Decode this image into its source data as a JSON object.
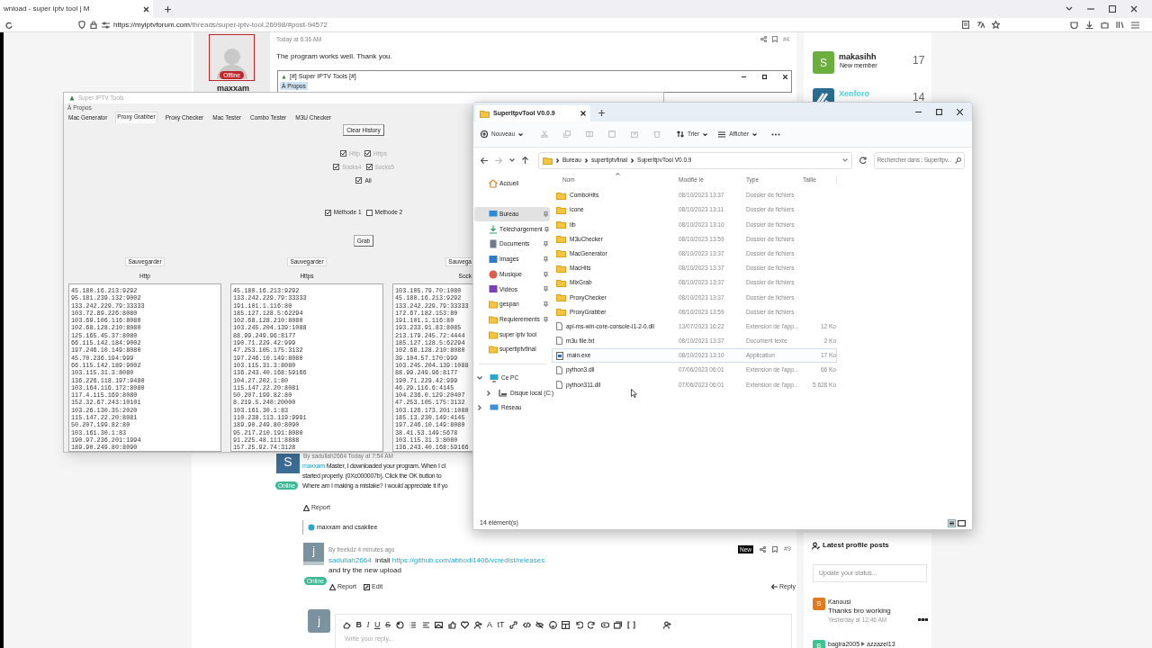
{
  "browser": {
    "tab_title": "wnload - super iptv tool | M",
    "url_host": "https://myiptvforum.com",
    "url_path": "/threads/super-iptv-tool.26998/#post-94572"
  },
  "forum": {
    "post_top": {
      "avatar_badge": "Offline",
      "username": "maxxam",
      "time": "Today at 6:36 AM",
      "number": "#4",
      "text": "The program works well. Thank you.",
      "embedded_window": {
        "title": "[#] Super IPTV Tools [#]",
        "menu": "À Propos"
      }
    },
    "post_reply": {
      "avatar_letter": "S",
      "byline": "By sadullah2664 Today at 7:54 AM",
      "mention": "maxxam",
      "lines": [
        "Master, I downloaded your program. When I cl",
        "started properly. (0Xc000007b). Click the OK button to",
        "Where am I making a mistake? I would appreciate it if yo"
      ],
      "status_badge": "Online",
      "report": "Report",
      "reactions": "maxxam and csakilee"
    },
    "post_last": {
      "avatar_letter": "j",
      "byline": "By freekdz 4 minutes ago",
      "badge": "New",
      "number": "#9",
      "mention": "sadullah2664",
      "word": "intall",
      "link": "https://github.com/abbodi1406/vcredist/releases",
      "line2": "and try the new upload",
      "status_badge": "Online",
      "actions": [
        {
          "kind": "report",
          "label": "Report"
        },
        {
          "kind": "edit",
          "label": "Edit"
        }
      ],
      "reply": "Reply"
    },
    "editor": {
      "avatar_letter": "j",
      "placeholder": "Write your reply...",
      "tools": [
        {
          "kind": "eraser"
        },
        {
          "kind": "bold",
          "glyph": "B"
        },
        {
          "kind": "italic",
          "glyph": "I"
        },
        {
          "kind": "underline",
          "glyph": "U"
        },
        {
          "kind": "strike",
          "glyph": "S"
        },
        {
          "kind": "palette"
        },
        {
          "kind": "list"
        },
        {
          "kind": "align"
        },
        {
          "kind": "image"
        },
        {
          "kind": "thumb"
        },
        {
          "kind": "heart"
        },
        {
          "kind": "user-add"
        },
        {
          "kind": "font-color",
          "glyph": "A"
        },
        {
          "kind": "font-size",
          "glyph": "tT"
        },
        {
          "kind": "link"
        },
        {
          "kind": "code"
        },
        {
          "kind": "hide"
        },
        {
          "kind": "smiley"
        },
        {
          "kind": "table"
        },
        {
          "kind": "undo"
        },
        {
          "kind": "redo"
        },
        {
          "kind": "media"
        },
        {
          "kind": "gallery"
        },
        {
          "kind": "brackets"
        },
        {
          "kind": "mention"
        }
      ]
    }
  },
  "sidebar": {
    "members": [
      {
        "kind": "letter",
        "avatar_letter": "S",
        "color": "#6aae3c",
        "name": "makasihh",
        "role": "New member",
        "count": "17"
      },
      {
        "kind": "logo",
        "name": "Xenforo",
        "count": "14"
      }
    ],
    "profile_posts": {
      "title": "Latest profile posts",
      "placeholder": "Update your status...",
      "posts": [
        {
          "avatar_letter": "S",
          "color": "#e07a1c",
          "author": "Kanousi",
          "text": "Thanks bro working",
          "time": "Yesterday at 12:46 AM"
        },
        {
          "avatar_letter": "B",
          "color": "#3cc48f",
          "author": "bagira2005",
          "target": "azzazel13"
        }
      ]
    }
  },
  "tool_window": {
    "title": "Super IPTV Tools",
    "menu": "À Propos",
    "tabs": [
      {
        "label": "Mac Generator",
        "selected": false
      },
      {
        "label": "Proxy Grabber",
        "selected": true
      },
      {
        "label": "Proxy Checker",
        "selected": false
      },
      {
        "label": "Mac Tester",
        "selected": false
      },
      {
        "label": "Combo Tester",
        "selected": false
      },
      {
        "label": "M3U Checker",
        "selected": false
      }
    ],
    "clear_button": "Clear History",
    "protocols": [
      {
        "label": "Http",
        "checked": true,
        "disabled": true
      },
      {
        "label": "Https",
        "checked": true,
        "disabled": true
      },
      {
        "label": "Socks4",
        "checked": true,
        "disabled": true
      },
      {
        "label": "Socks5",
        "checked": true,
        "disabled": true
      },
      {
        "label": "All",
        "checked": true,
        "disabled": false
      }
    ],
    "methods": [
      {
        "label": "Methode 1",
        "checked": true
      },
      {
        "label": "Methode 2",
        "checked": false
      }
    ],
    "grab_button": "Grab",
    "columns": [
      {
        "save_button": "Sauvegarder",
        "label": "Http",
        "lines": [
          "45.180.16.213:9292",
          "95.181.239.132:9002",
          "133.242.229.79:33333",
          "103.72.89.226:8080",
          "103.69.106.116:8080",
          "102.68.128.210:8080",
          "125.165.45.37:8080",
          "66.115.142.184:9002",
          "197.246.10.149:8080",
          "45.70.236.194:999",
          "66.115.142.189:9002",
          "103.115.31.3:8080",
          "136.226.118.197:9480",
          "103.164.116.172:8080",
          "117.4.115.169:8080",
          "152.32.67.243:10101",
          "103.26.130.35:2020",
          "115.147.22.20:8081",
          "50.207.199.82:80",
          "103.161.30.1:83",
          "190.97.236.201:1994",
          "189.90.249.80:8090"
        ]
      },
      {
        "save_button": "Sauvegarder",
        "label": "Https",
        "lines": [
          "45.180.16.213:9292",
          "133.242.229.79:33333",
          "191.101.1.116:80",
          "185.127.128.5:62294",
          "102.68.128.210:8080",
          "103.245.204.139:1088",
          "88.99.249.96:8177",
          "190.71.229.42:999",
          "47.253.105.175:3132",
          "197.246.10.149:8080",
          "103.115.31.3:8080",
          "136.243.40.168:59166",
          "104.27.202.1:80",
          "115.147.22.20:8081",
          "50.207.199.82:80",
          "8.219.5.240:20000",
          "103.161.30.1:83",
          "110.238.113.119:9991",
          "189.90.249.80:8090",
          "95.217.210.191:8080",
          "91.225.48.111:8888",
          "157.25.92.74:3128"
        ]
      },
      {
        "save_button": "Sauvega",
        "label": "Sock",
        "lines": [
          "103.105.79.70:1080",
          "45.180.16.213:9292",
          "133.242.229.79:33333",
          "172.67.182.153:80",
          "191.101.1.116:80",
          "193.233.91.83:8085",
          "213.179.245.72:4444",
          "185.127.128.5:62294",
          "102.68.128.210:8080",
          "39.104.57.170:999",
          "103.245.204.139:1088",
          "88.99.249.96:8177",
          "190.71.229.42:999",
          "46.29.116.6:4145",
          "104.236.0.129:20407",
          "47.253.105.175:3132",
          "103.126.173.201:1080",
          "185.13.230.149:4145",
          "197.246.10.149:8080",
          "38.41.53.149:5678",
          "103.115.31.3:8080",
          "136.243.40.168:59166"
        ]
      }
    ]
  },
  "explorer": {
    "tab_title": "SuperItpvTool V0.0.9",
    "new_label": "Nouveau",
    "sort_label": "Trier",
    "view_label": "Afficher",
    "breadcrumb": [
      "Bureau",
      "supertiptvfinal",
      "SuperItpvTool V0.0.9"
    ],
    "search_placeholder": "Rechercher dans : SuperItpv...",
    "nav": [
      {
        "kind": "home",
        "label": "Accueil",
        "pinned": false,
        "selected": false
      },
      {
        "kind": "desktop",
        "label": "Bureau",
        "pinned": true,
        "selected": true
      },
      {
        "kind": "download",
        "label": "Téléchargement",
        "pinned": true,
        "selected": false
      },
      {
        "kind": "documents",
        "label": "Documents",
        "pinned": true,
        "selected": false
      },
      {
        "kind": "images",
        "label": "Images",
        "pinned": true,
        "selected": false
      },
      {
        "kind": "music",
        "label": "Musique",
        "pinned": true,
        "selected": false
      },
      {
        "kind": "videos",
        "label": "Vidéos",
        "pinned": true,
        "selected": false
      },
      {
        "kind": "folder",
        "label": "gespan",
        "pinned": true,
        "selected": false
      },
      {
        "kind": "folder",
        "label": "Requierements",
        "pinned": true,
        "selected": false
      },
      {
        "kind": "folder",
        "label": "super iptv tool",
        "pinned": false,
        "selected": false
      },
      {
        "kind": "folder",
        "label": "supertiptvfinal",
        "pinned": false,
        "selected": false
      }
    ],
    "tree": [
      {
        "kind": "pc",
        "label": "Ce PC",
        "expanded": true,
        "children": [
          {
            "kind": "drive",
            "label": "Disque local (C:)",
            "expanded": false
          }
        ]
      },
      {
        "kind": "network",
        "label": "Réseau",
        "expanded": false
      }
    ],
    "columns": [
      "Nom",
      "Modifié le",
      "Type",
      "Taille"
    ],
    "files": [
      {
        "kind": "folder",
        "name": "ComboHits",
        "modified": "08/10/2023 13:37",
        "type": "Dossier de fichiers",
        "selected": false
      },
      {
        "kind": "folder",
        "name": "icone",
        "modified": "08/10/2023 13:11",
        "type": "Dossier de fichiers",
        "selected": false
      },
      {
        "kind": "folder",
        "name": "lib",
        "modified": "08/10/2023 13:10",
        "type": "Dossier de fichiers",
        "selected": false
      },
      {
        "kind": "folder",
        "name": "M3uChecker",
        "modified": "08/10/2023 13:59",
        "type": "Dossier de fichiers",
        "selected": false
      },
      {
        "kind": "folder",
        "name": "MacGenerator",
        "modified": "08/10/2023 13:37",
        "type": "Dossier de fichiers",
        "selected": false
      },
      {
        "kind": "folder",
        "name": "MacHits",
        "modified": "08/10/2023 13:37",
        "type": "Dossier de fichiers",
        "selected": false
      },
      {
        "kind": "folder",
        "name": "MixGrab",
        "modified": "08/10/2023 13:37",
        "type": "Dossier de fichiers",
        "selected": false
      },
      {
        "kind": "folder",
        "name": "ProxyChecker",
        "modified": "08/10/2023 13:37",
        "type": "Dossier de fichiers",
        "selected": false
      },
      {
        "kind": "folder",
        "name": "ProxyGrabber",
        "modified": "08/10/2023 13:59",
        "type": "Dossier de fichiers",
        "selected": false
      },
      {
        "kind": "file",
        "name": "api-ms-win-core-console-l1-2-0.dll",
        "modified": "13/07/2023 16:22",
        "type": "Extension de l'app...",
        "size": "12 Ko",
        "selected": false
      },
      {
        "kind": "file",
        "name": "m3u file.txt",
        "modified": "08/10/2023 13:37",
        "type": "Document texte",
        "size": "2 Ko",
        "selected": false
      },
      {
        "kind": "exe",
        "name": "main.exe",
        "modified": "08/10/2023 13:10",
        "type": "Application",
        "size": "17 Ko",
        "selected": true
      },
      {
        "kind": "file",
        "name": "python3.dll",
        "modified": "07/06/2023 06:01",
        "type": "Extension de l'app...",
        "size": "66 Ko",
        "selected": false
      },
      {
        "kind": "file",
        "name": "python311.dll",
        "modified": "07/06/2023 06:01",
        "type": "Extension de l'app...",
        "size": "5 628 Ko",
        "selected": false
      }
    ],
    "status": "14 élément(s)"
  }
}
